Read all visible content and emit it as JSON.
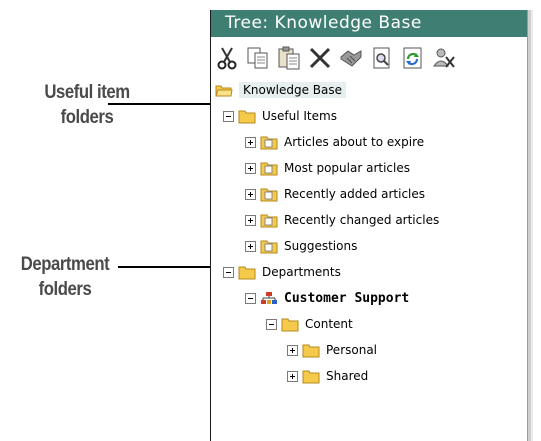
{
  "callouts": {
    "useful_line1": "Useful item",
    "useful_line2": "folders",
    "dept_line1": "Department",
    "dept_line2": "folders"
  },
  "window": {
    "title": "Tree: Knowledge Base"
  },
  "toolbar": {
    "buttons": [
      {
        "icon": "cut-icon"
      },
      {
        "icon": "copy-icon"
      },
      {
        "icon": "paste-icon"
      },
      {
        "icon": "delete-icon"
      },
      {
        "icon": "handshake-icon"
      },
      {
        "icon": "search-document-icon"
      },
      {
        "icon": "refresh-icon"
      },
      {
        "icon": "permissions-icon"
      }
    ]
  },
  "tree": {
    "root": "Knowledge Base",
    "useful_items": {
      "label": "Useful Items",
      "children": [
        "Articles about to expire",
        "Most popular articles",
        "Recently added articles",
        "Recently changed articles",
        "Suggestions"
      ]
    },
    "departments": {
      "label": "Departments",
      "customer_support": {
        "label": "Customer Support",
        "content": {
          "label": "Content",
          "children": [
            "Personal",
            "Shared"
          ]
        }
      }
    }
  },
  "colors": {
    "titlebar": "#3f7f73",
    "folder": "#f5c94a"
  }
}
